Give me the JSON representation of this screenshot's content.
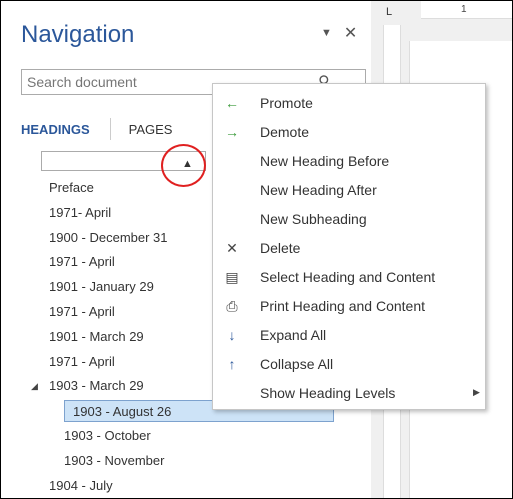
{
  "nav": {
    "title": "Navigation",
    "dropdown_glyph": "▼",
    "close_glyph": "✕",
    "search_placeholder": "Search document",
    "search_glyph": "⚲",
    "tabs": [
      {
        "label": "HEADINGS",
        "active": true
      },
      {
        "label": "PAGES",
        "active": false
      }
    ],
    "collapse_glyph": "▲",
    "expander_glyph": "◢",
    "headings": [
      {
        "label": "Preface",
        "level": 1
      },
      {
        "label": "1971- April",
        "level": 1
      },
      {
        "label": "1900 - December 31",
        "level": 1
      },
      {
        "label": "1971 - April",
        "level": 1
      },
      {
        "label": "1901 - January 29",
        "level": 1
      },
      {
        "label": "1971 - April",
        "level": 1
      },
      {
        "label": "1901 - March 29",
        "level": 1
      },
      {
        "label": "1971 - April",
        "level": 1
      },
      {
        "label": "1903 - March 29",
        "level": 1,
        "expanded": true
      },
      {
        "label": "1903 - August 26",
        "level": 2,
        "selected": true
      },
      {
        "label": "1903 - October",
        "level": 2
      },
      {
        "label": "1903 - November",
        "level": 2
      },
      {
        "label": "1904 - July",
        "level": 1
      }
    ]
  },
  "ruler": {
    "corner_glyph": "L",
    "number": "1"
  },
  "menu": {
    "items": [
      {
        "label": "Promote",
        "icon": "promote-arrow-icon",
        "glyph": "←",
        "tone": "green"
      },
      {
        "label": "Demote",
        "icon": "demote-arrow-icon",
        "glyph": "→",
        "tone": "green"
      },
      {
        "label": "New Heading Before",
        "icon": "",
        "glyph": ""
      },
      {
        "label": "New Heading After",
        "icon": "",
        "glyph": ""
      },
      {
        "label": "New Subheading",
        "icon": "",
        "glyph": ""
      },
      {
        "label": "Delete",
        "icon": "delete-x-icon",
        "glyph": "✕",
        "tone": "dark"
      },
      {
        "label": "Select Heading and Content",
        "icon": "select-content-icon",
        "glyph": "▤",
        "tone": "dark"
      },
      {
        "label": "Print Heading and Content",
        "icon": "printer-icon",
        "glyph": "⎙",
        "tone": "dark"
      },
      {
        "label": "Expand All",
        "icon": "expand-all-icon",
        "glyph": "↓",
        "tone": "blue"
      },
      {
        "label": "Collapse All",
        "icon": "collapse-all-icon",
        "glyph": "↑",
        "tone": "blue"
      },
      {
        "label": "Show Heading Levels",
        "icon": "",
        "glyph": "",
        "submenu": true,
        "submenu_glyph": "▶"
      }
    ]
  },
  "colors": {
    "accent": "#2b579a",
    "selected_bg": "#cde3f7",
    "annotation_circle": "#e02020"
  }
}
